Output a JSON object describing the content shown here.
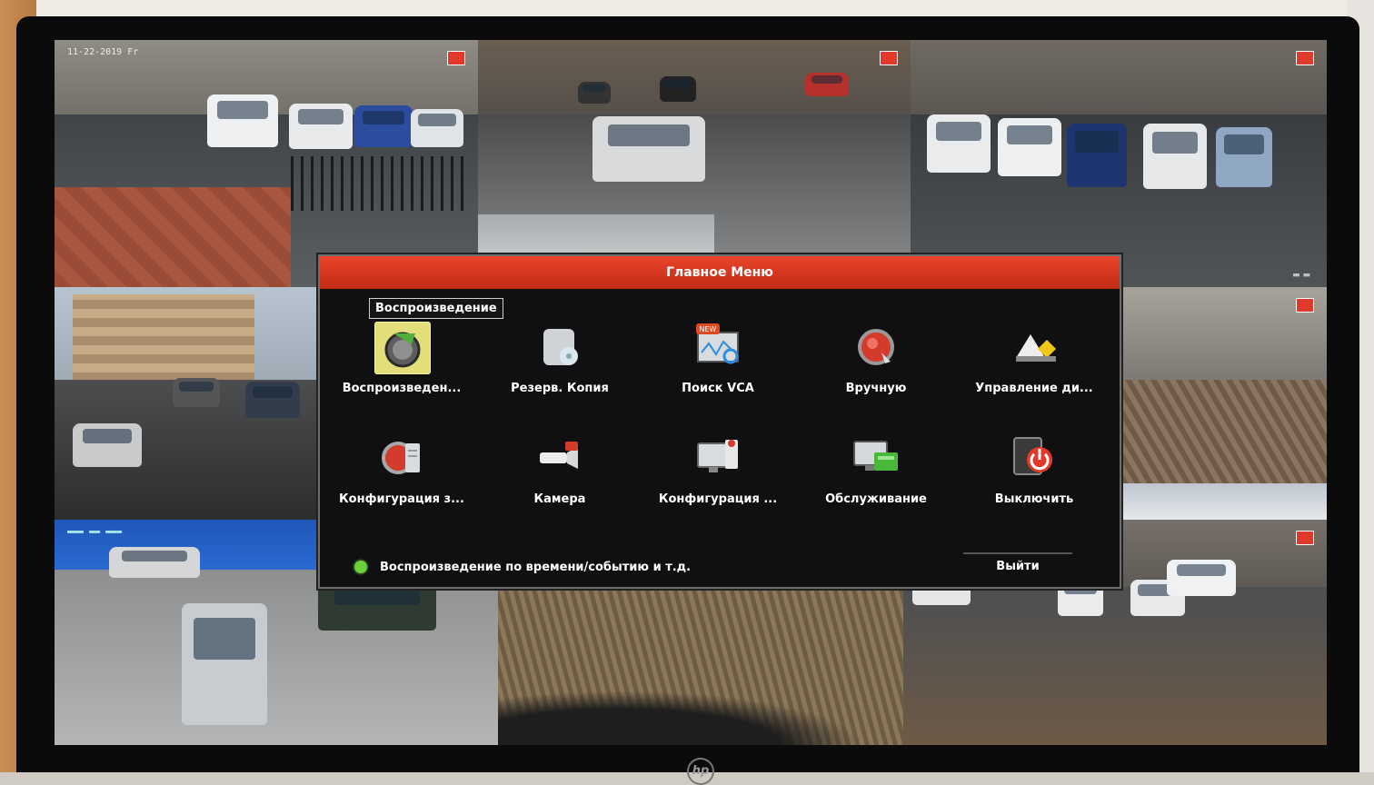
{
  "dialog": {
    "title": "Главное Меню",
    "tooltip": "Воспроизведение",
    "items": [
      {
        "label": "Воспроизведен...",
        "icon": "playback-icon",
        "selected": true
      },
      {
        "label": "Резерв. Копия",
        "icon": "backup-icon"
      },
      {
        "label": "Поиск VCA",
        "icon": "vca-search-icon",
        "badge": "NEW"
      },
      {
        "label": "Вручную",
        "icon": "manual-record-icon"
      },
      {
        "label": "Управление ди...",
        "icon": "disk-management-icon"
      },
      {
        "label": "Конфигурация з...",
        "icon": "record-config-icon"
      },
      {
        "label": "Камера",
        "icon": "camera-icon"
      },
      {
        "label": "Конфигурация ...",
        "icon": "system-config-icon"
      },
      {
        "label": "Обслуживание",
        "icon": "maintenance-icon"
      },
      {
        "label": "Выключить",
        "icon": "shutdown-icon"
      }
    ],
    "status": "Воспроизведение по времени/событию и т.д.",
    "exit_label": "Выйти"
  },
  "camera_feed": {
    "timestamp": "11-22-2019 Fr"
  },
  "monitor": {
    "logo": "hp"
  },
  "colors": {
    "header": "#d8361c",
    "status_dot": "#6bcf3b",
    "selected_tile": "#e2df7a"
  }
}
